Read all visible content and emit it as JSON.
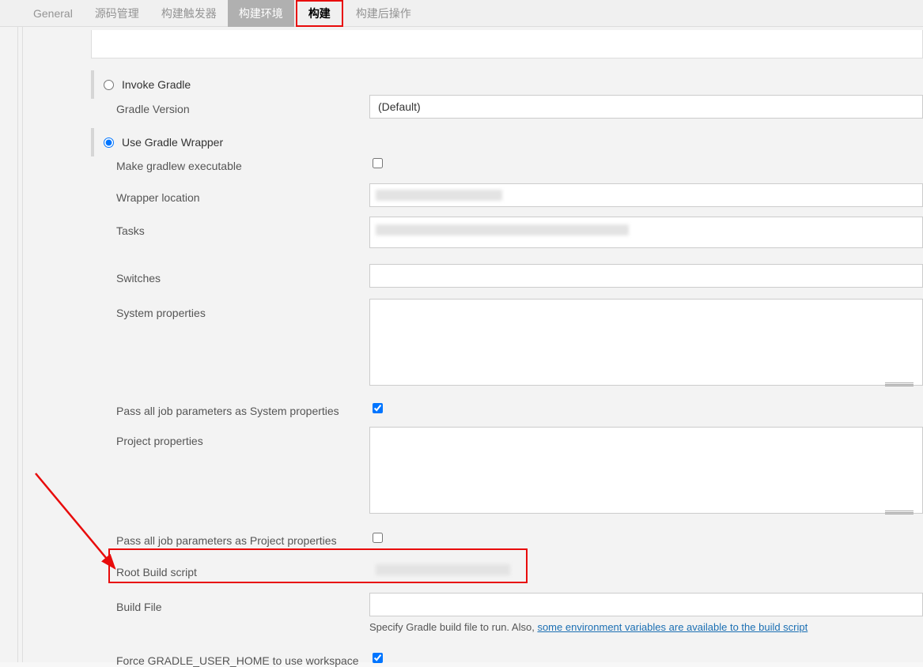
{
  "tabs": {
    "general": "General",
    "scm": "源码管理",
    "triggers": "构建触发器",
    "env": "构建环境",
    "build": "构建",
    "post": "构建后操作"
  },
  "invoke_gradle": {
    "label": "Invoke Gradle"
  },
  "gradle_version": {
    "label": "Gradle Version",
    "value": "(Default)"
  },
  "use_wrapper": {
    "label": "Use Gradle Wrapper"
  },
  "make_executable": {
    "label": "Make gradlew executable"
  },
  "wrapper_location": {
    "label": "Wrapper location"
  },
  "tasks": {
    "label": "Tasks"
  },
  "switches": {
    "label": "Switches"
  },
  "system_props": {
    "label": "System properties"
  },
  "pass_sys": {
    "label": "Pass all job parameters as System properties"
  },
  "project_props": {
    "label": "Project properties"
  },
  "pass_proj": {
    "label": "Pass all job parameters as Project properties"
  },
  "root_build": {
    "label": "Root Build script"
  },
  "build_file": {
    "label": "Build File",
    "hint_prefix": "Specify Gradle build file to run. Also, ",
    "hint_link": "some environment variables are available to the build script"
  },
  "force_home": {
    "label": "Force GRADLE_USER_HOME to use workspace"
  }
}
